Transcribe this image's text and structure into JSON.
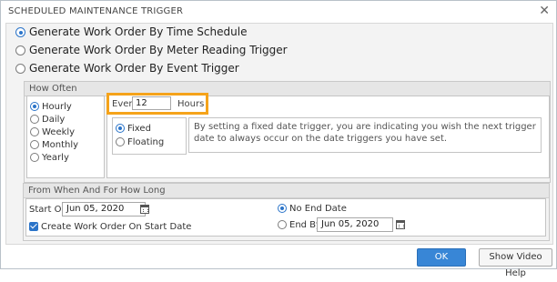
{
  "dialog": {
    "title": "SCHEDULED MAINTENANCE TRIGGER",
    "close_icon": "close-icon"
  },
  "triggers": [
    {
      "label": "Generate Work Order By Time Schedule",
      "selected": true
    },
    {
      "label": "Generate Work Order By Meter Reading Trigger",
      "selected": false
    },
    {
      "label": "Generate Work Order By Event Trigger",
      "selected": false
    }
  ],
  "how_often": {
    "header": "How Often",
    "frequencies": [
      {
        "label": "Hourly",
        "selected": true
      },
      {
        "label": "Daily",
        "selected": false
      },
      {
        "label": "Weekly",
        "selected": false
      },
      {
        "label": "Monthly",
        "selected": false
      },
      {
        "label": "Yearly",
        "selected": false
      }
    ],
    "every_label": "Every",
    "every_value": "12",
    "unit_label": "Hours",
    "modes": [
      {
        "label": "Fixed",
        "selected": true
      },
      {
        "label": "Floating",
        "selected": false
      }
    ],
    "description": "By setting a fixed date trigger, you are indicating you wish the next trigger date to always occur on the date triggers you have set."
  },
  "duration": {
    "header": "From When And For How Long",
    "start_label": "Start On",
    "start_value": "Jun 05, 2020",
    "create_on_start_label": "Create Work Order On Start Date",
    "create_on_start_checked": true,
    "end_options": [
      {
        "label": "No End Date",
        "selected": true
      },
      {
        "label": "End By",
        "selected": false
      }
    ],
    "end_value": "Jun 05, 2020"
  },
  "buttons": {
    "ok": "OK",
    "video_help": "Show Video Help"
  },
  "colors": {
    "accent": "#2b74c9",
    "highlight": "#f5a31a",
    "ok_button": "#3886d6"
  }
}
